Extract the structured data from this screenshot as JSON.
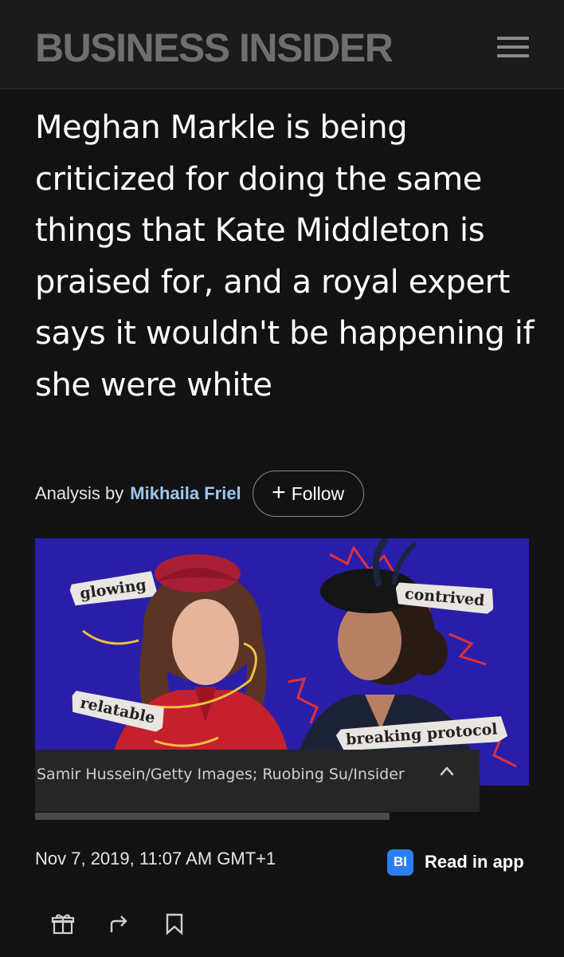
{
  "header": {
    "logo_text": "BUSINESS INSIDER",
    "menu_icon": "hamburger-menu-icon"
  },
  "article": {
    "headline": "Meghan Markle is being criticized for doing the same things that Kate Middleton is praised for, and a royal expert says it wouldn't be happening if she were white",
    "byline_prefix": "Analysis by",
    "author": "Mikhaila Friel",
    "follow_label": "Follow",
    "date": "Nov 7, 2019, 11:07 AM GMT+1"
  },
  "hero": {
    "tags": [
      "glowing",
      "contrived",
      "relatable",
      "breaking protocol"
    ],
    "caption": "Samir Hussein/Getty Images; Ruobing Su/Insider",
    "background_color": "#2a1ea8"
  },
  "app_promo": {
    "badge": "BI",
    "label": "Read in app",
    "badge_color": "#2d7df0"
  },
  "actions": {
    "icons": [
      "gift-icon",
      "share-icon",
      "bookmark-icon"
    ]
  },
  "colors": {
    "background": "#121212",
    "author_link": "#9cc7f0"
  }
}
